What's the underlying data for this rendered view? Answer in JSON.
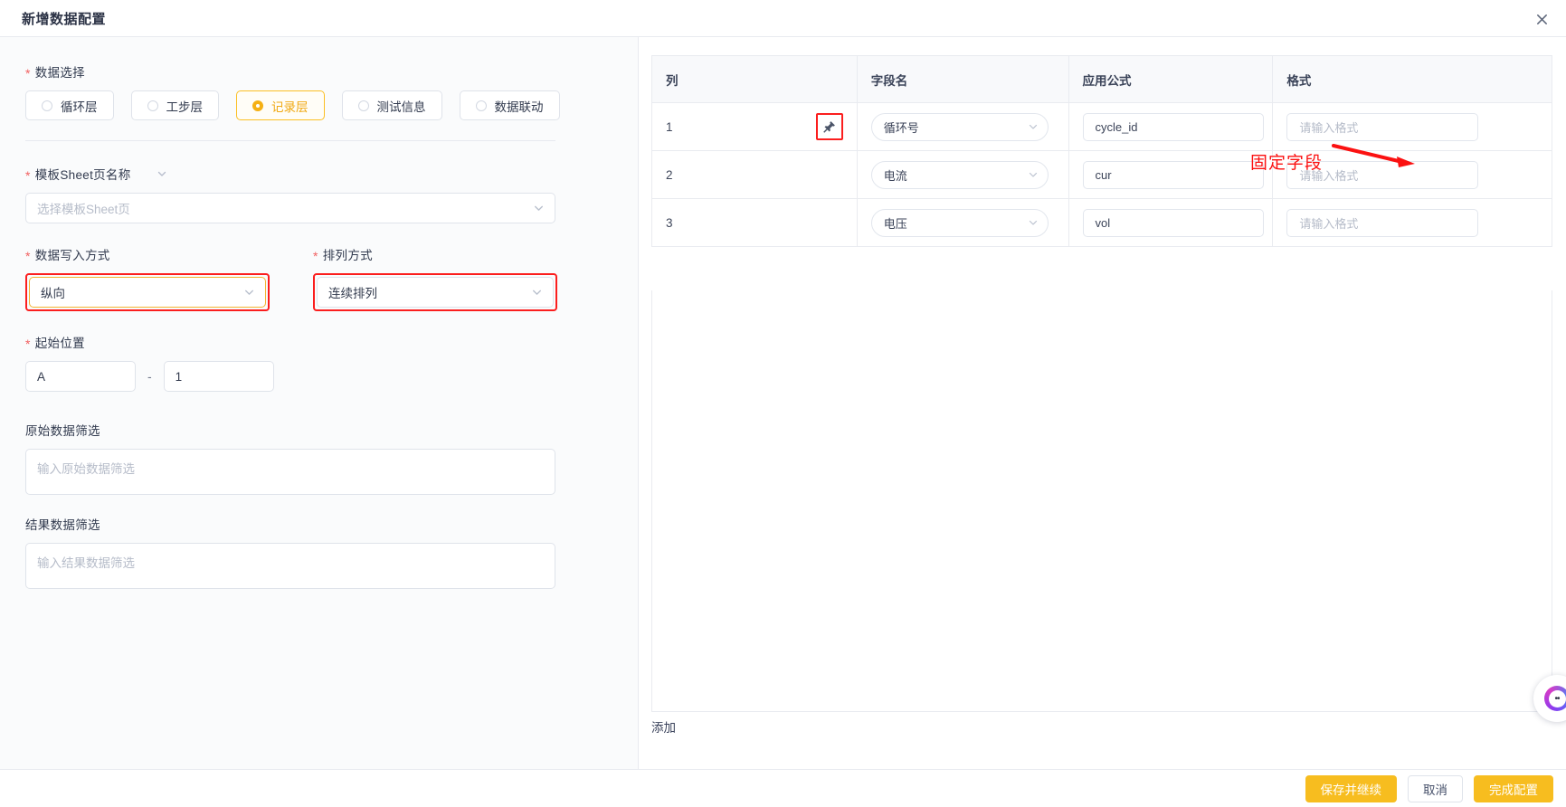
{
  "window": {
    "title": "新增数据配置",
    "close_icon": "close-icon"
  },
  "left": {
    "data_select": {
      "label": "数据选择",
      "required": true,
      "options": [
        {
          "label": "循环层",
          "selected": false
        },
        {
          "label": "工步层",
          "selected": false
        },
        {
          "label": "记录层",
          "selected": true
        },
        {
          "label": "测试信息",
          "selected": false
        },
        {
          "label": "数据联动",
          "selected": false
        }
      ]
    },
    "sheet_name": {
      "label": "模板Sheet页名称",
      "required": true,
      "chevron_icon": "chevron-down-icon",
      "value": "",
      "placeholder": "选择模板Sheet页"
    },
    "write_mode": {
      "label": "数据写入方式",
      "required": true,
      "value": "纵向",
      "highlighted": true
    },
    "arrange_mode": {
      "label": "排列方式",
      "required": true,
      "value": "连续排列",
      "highlighted": true
    },
    "start_position": {
      "label": "起始位置",
      "required": true,
      "col_value": "A",
      "separator": "-",
      "row_value": "1"
    },
    "raw_filter": {
      "label": "原始数据筛选",
      "required": false,
      "value": "",
      "placeholder": "输入原始数据筛选"
    },
    "result_filter": {
      "label": "结果数据筛选",
      "required": false,
      "value": "",
      "placeholder": "输入结果数据筛选"
    }
  },
  "table": {
    "columns": [
      "列",
      "字段名",
      "应用公式",
      "格式"
    ],
    "rows": [
      {
        "num": "1",
        "pinned": true,
        "pin_icon": "pin-icon",
        "field": "循环号",
        "formula": "cycle_id",
        "format": "",
        "format_placeholder": "请输入格式"
      },
      {
        "num": "2",
        "pinned": false,
        "field": "电流",
        "formula": "cur",
        "format": "",
        "format_placeholder": "请输入格式"
      },
      {
        "num": "3",
        "pinned": false,
        "field": "电压",
        "formula": "vol",
        "format": "",
        "format_placeholder": "请输入格式"
      }
    ],
    "add_label": "添加"
  },
  "annotation": {
    "text": "固定字段",
    "color": "#fb1111"
  },
  "footer": {
    "save_continue": "保存并继续",
    "cancel": "取消",
    "finish": "完成配置"
  },
  "floating_widget": {
    "name": "assistant-bubble"
  },
  "colors": {
    "accent": "#f5b014",
    "annotation_red": "#fb1111",
    "required_red": "#f26161",
    "border": "#e9ebf0"
  }
}
